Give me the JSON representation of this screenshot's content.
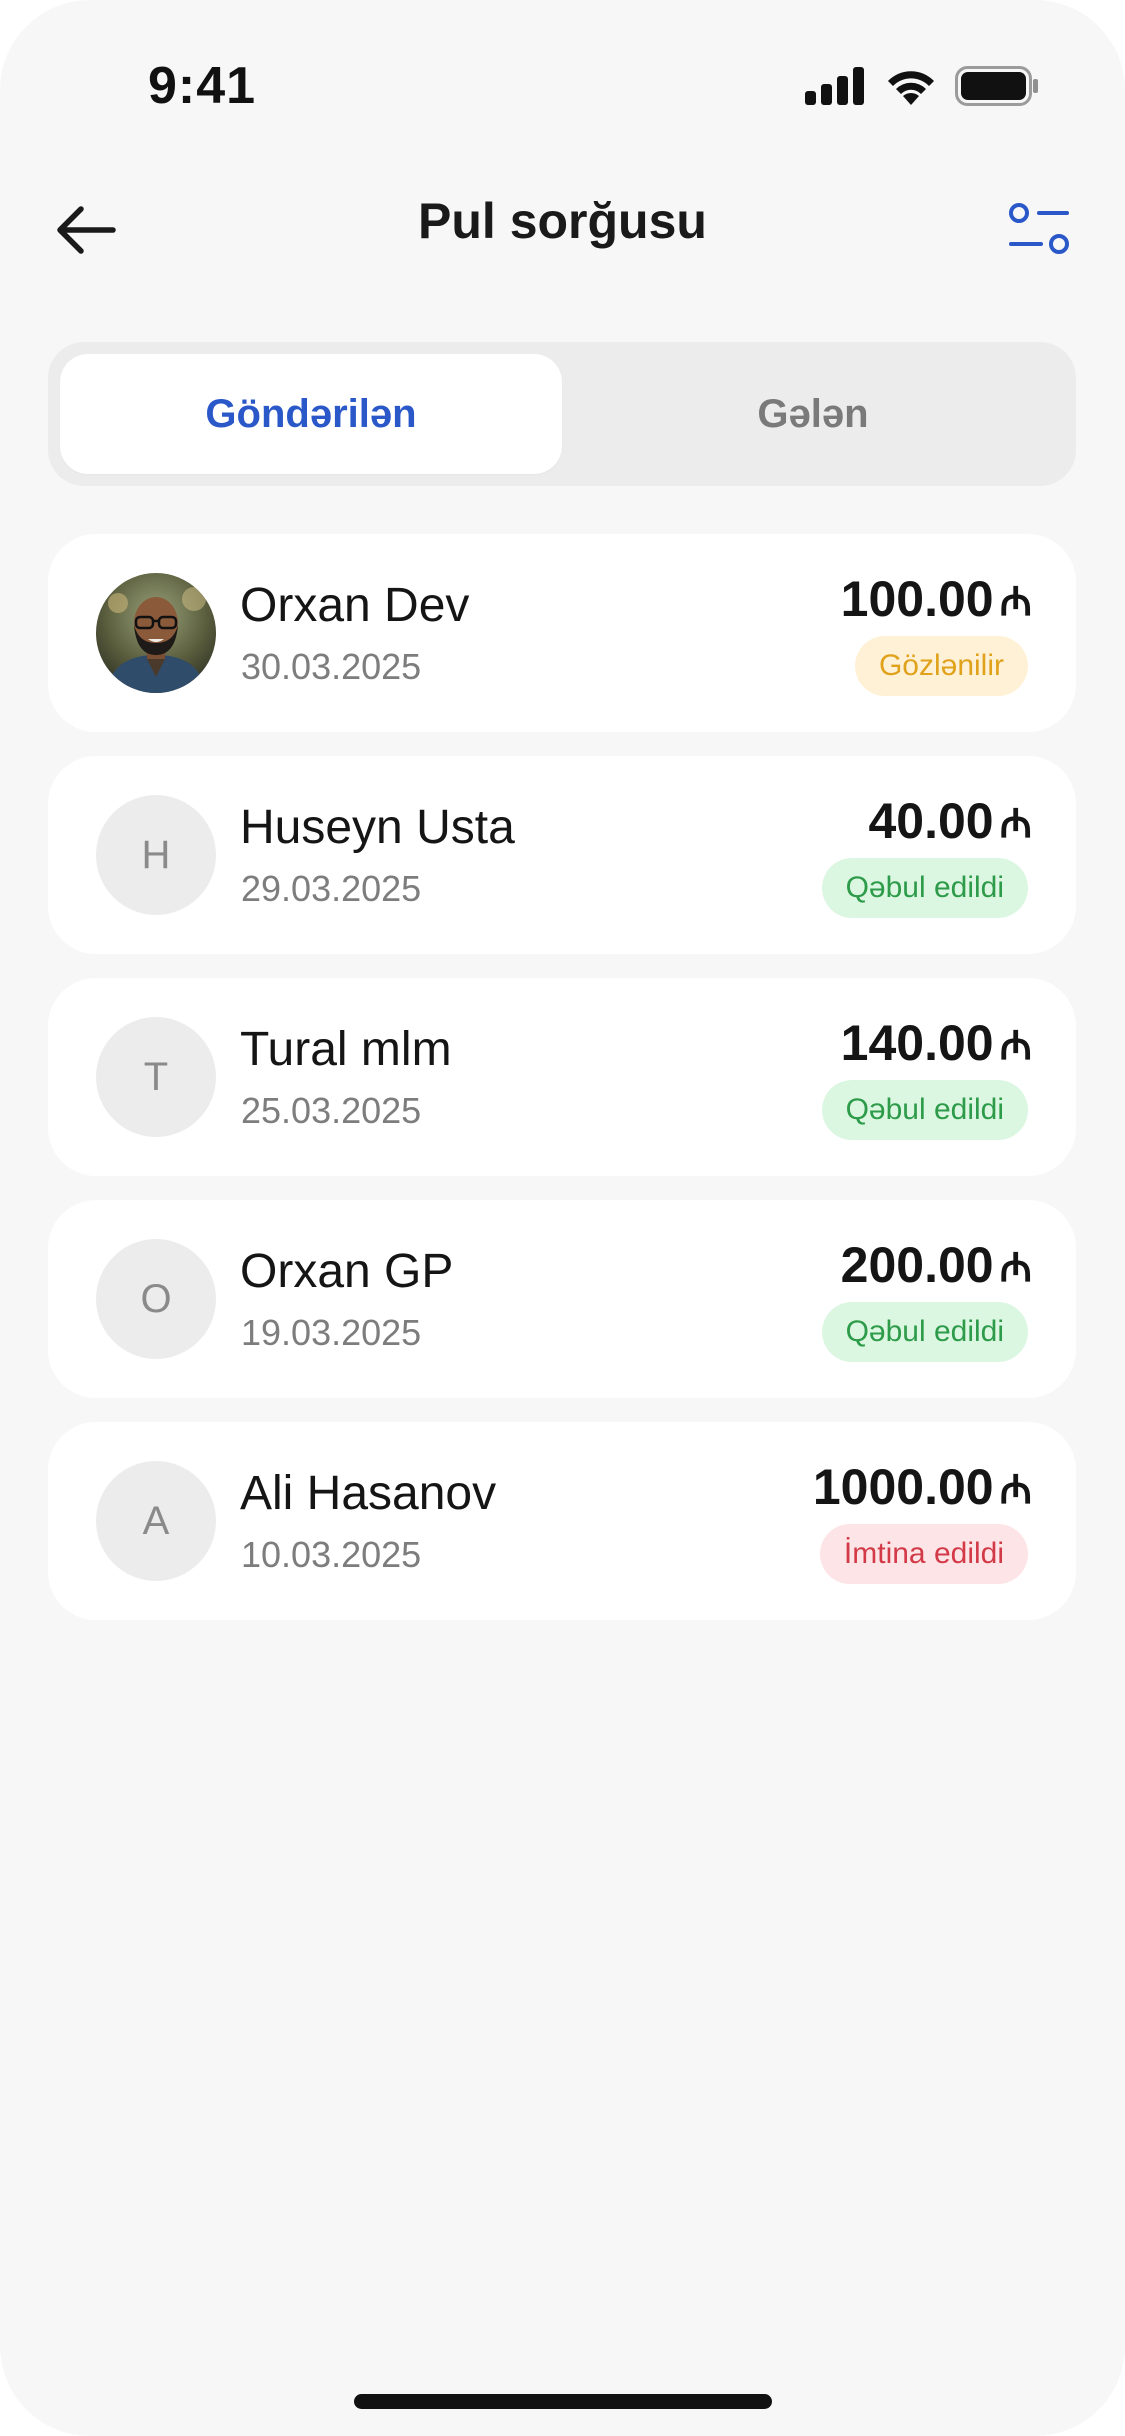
{
  "status_bar": {
    "time": "9:41"
  },
  "header": {
    "title": "Pul sorğusu"
  },
  "tabs": [
    {
      "label": "Göndərilən",
      "active": true
    },
    {
      "label": "Gələn",
      "active": false
    }
  ],
  "currency_symbol": "₼",
  "requests": [
    {
      "name": "Orxan Dev",
      "date": "30.03.2025",
      "amount": "100.00",
      "status": "Gözlənilir",
      "initial": "",
      "has_photo": true,
      "badge_bg": "#fff1d6",
      "badge_fg": "#e0a21b"
    },
    {
      "name": "Huseyn Usta",
      "date": "29.03.2025",
      "amount": "40.00",
      "status": "Qəbul edildi",
      "initial": "H",
      "has_photo": false,
      "badge_bg": "#dcf7e1",
      "badge_fg": "#2d9b49"
    },
    {
      "name": "Tural mlm",
      "date": "25.03.2025",
      "amount": "140.00",
      "status": "Qəbul edildi",
      "initial": "T",
      "has_photo": false,
      "badge_bg": "#dcf7e1",
      "badge_fg": "#2d9b49"
    },
    {
      "name": "Orxan GP",
      "date": "19.03.2025",
      "amount": "200.00",
      "status": "Qəbul edildi",
      "initial": "O",
      "has_photo": false,
      "badge_bg": "#dcf7e1",
      "badge_fg": "#2d9b49"
    },
    {
      "name": "Ali Hasanov",
      "date": "10.03.2025",
      "amount": "1000.00",
      "status": "İmtina edildi",
      "initial": "A",
      "has_photo": false,
      "badge_bg": "#fde5e7",
      "badge_fg": "#d33a47"
    }
  ],
  "colors": {
    "accent": "#2a58c9",
    "background": "#f7f7f7"
  },
  "icons": {
    "back": "arrow-left-icon",
    "filter": "filter-sliders-icon"
  }
}
